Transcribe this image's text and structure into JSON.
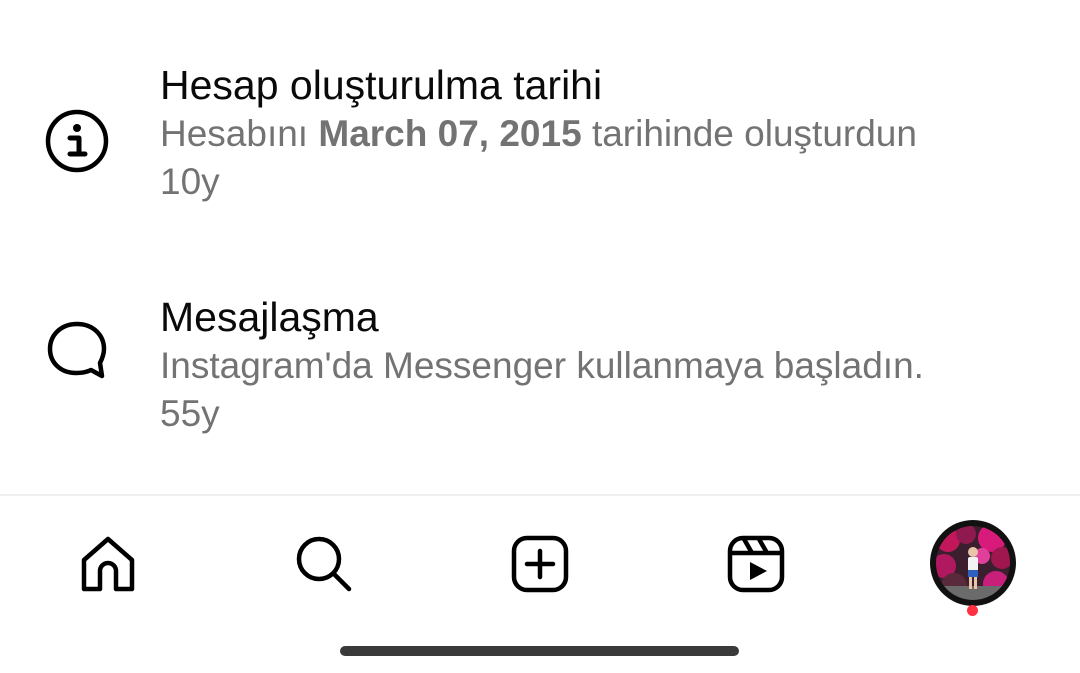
{
  "activity": {
    "items": [
      {
        "icon": "info-icon",
        "title": "Hesap oluşturulma tarihi",
        "desc_prefix": "Hesabını ",
        "desc_bold": "March 07, 2015",
        "desc_suffix": " tarihinde oluşturdun",
        "time": "10y"
      },
      {
        "icon": "message-bubble-icon",
        "title": "Mesajlaşma",
        "desc": "Instagram'da Messenger kullanmaya başladın.",
        "time": "55y"
      }
    ]
  },
  "tabbar": {
    "tabs": [
      "home-icon",
      "search-icon",
      "create-icon",
      "reels-icon",
      "profile-avatar"
    ],
    "notification_color": "#ff3040"
  }
}
